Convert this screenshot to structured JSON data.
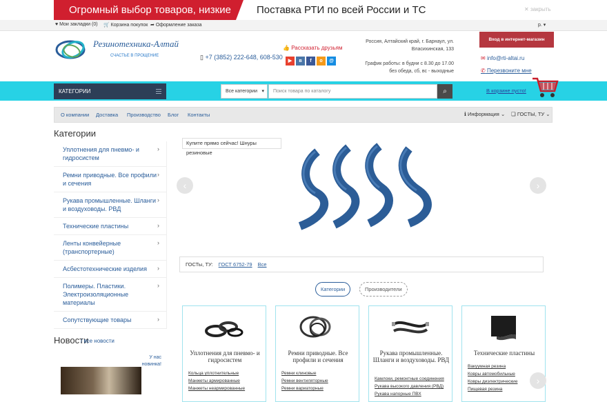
{
  "banner": {
    "left_text": "Огромный выбор товаров, низкие цены!",
    "right_text": "Поставка РТИ по всей России и ТС",
    "close": "закрыть"
  },
  "topbar": {
    "bookmarks": "Мои закладки (0)",
    "cart": "Корзина покупок",
    "checkout": "Оформление заказа",
    "currency": "р."
  },
  "header": {
    "logo_title": "Резинотехника-Алтай",
    "logo_subtitle": "СЧАСТЬЕ В ПРОЩЕНИЕ",
    "phone": "+7 (3852) 222-648, 608-530",
    "tell_friends": "Рассказать друзьям",
    "address": "Россия, Алтайский край, г. Барнаул, ул. Власихинская, 133",
    "hours": "График работы: в будни с 8.30 до 17.00 без обеда, сб, вс - выходные",
    "login": "Вход в интернет-магазин",
    "email": "info@rti-altai.ru",
    "callback": "Перезвоните мне"
  },
  "searchbar": {
    "categories_button": "КАТЕГОРИИ",
    "category_select": "Все категории",
    "search_placeholder": "Поиск товара по каталогу",
    "cart_status": "В корзине пусто!"
  },
  "nav": {
    "items": [
      "О компании",
      "Доставка",
      "Производство",
      "Блог",
      "Контакты"
    ],
    "info": "Информация",
    "gost": "ГОСТЫ, ТУ"
  },
  "sidebar": {
    "title": "Категории",
    "items": [
      "Уплотнения для пневмо- и гидросистем",
      "Ремни приводные. Все профили и сечения",
      "Рукава промышленные. Шланги и воздуховоды. РВД",
      "Технические пластины",
      "Ленты конвейерные (транспортерные)",
      "Асбестотехнические изделия",
      "Полимеры. Пластики. Электроизоляционные материалы",
      "Сопутствующие товары"
    ],
    "news_title": "Новости",
    "news_all": "/ все новости",
    "news_badge": "У нас новинка!"
  },
  "slider": {
    "tag": "Купите прямо сейчас! Шнуры резиновые"
  },
  "gost_bar": {
    "label": "ГОСТы, ТУ:",
    "link1": "ГОСТ 6752-79",
    "link2": "Все"
  },
  "tabs": {
    "categories": "Категории",
    "manufacturers": "Производители"
  },
  "cards": [
    {
      "title": "Уплотнения для пневмо- и гидросистем",
      "links": [
        "Кольца уплотнительные",
        "Манжеты армированные",
        "Манжеты неармированные"
      ]
    },
    {
      "title": "Ремни приводные. Все профили и сечения",
      "links": [
        "Ремни клиновые",
        "Ремни вентиляторные",
        "Ремни вариаторные"
      ]
    },
    {
      "title": "Рукава промышленные. Шланги и воздуховоды. РВД",
      "links": [
        "Камлоки, ремонтные соединения",
        "Рукава высокого давления (РВД)",
        "Рукава напорные ПВХ"
      ]
    },
    {
      "title": "Технические пластины",
      "links": [
        "Вакуумная резина",
        "Ковры автомобильные",
        "Ковры диэлектрические",
        "Пищевая резина"
      ]
    }
  ]
}
